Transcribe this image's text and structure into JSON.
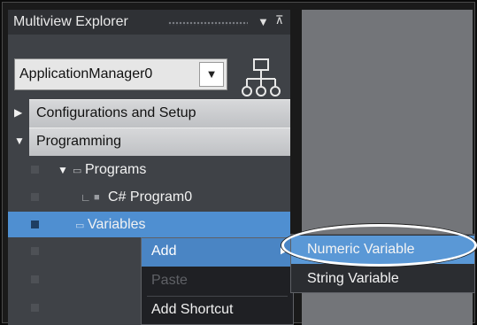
{
  "explorer": {
    "title": "Multiview Explorer",
    "dropdown_arrow": "chevron-down-icon",
    "pin": "pin-icon"
  },
  "project_selector": {
    "value": "ApplicationManager0",
    "button_icon": "triangle-down-icon",
    "hierarchy_icon": "hierarchy-icon"
  },
  "tree": {
    "configurations": {
      "label": "Configurations and Setup",
      "expander": "collapsed"
    },
    "programming": {
      "label": "Programming",
      "expander": "expanded"
    },
    "programs": {
      "label": "Programs"
    },
    "program0": {
      "label": "C# Program0"
    },
    "variables": {
      "label": "Variables"
    }
  },
  "context_menu": {
    "add": "Add",
    "paste": "Paste",
    "add_shortcut": "Add Shortcut"
  },
  "submenu": {
    "numeric_variable": "Numeric Variable",
    "string_variable": "String Variable"
  },
  "colors": {
    "selection": "#4f8fd1",
    "panel_bg": "#3f4247",
    "right_pane_bg": "#737579"
  }
}
